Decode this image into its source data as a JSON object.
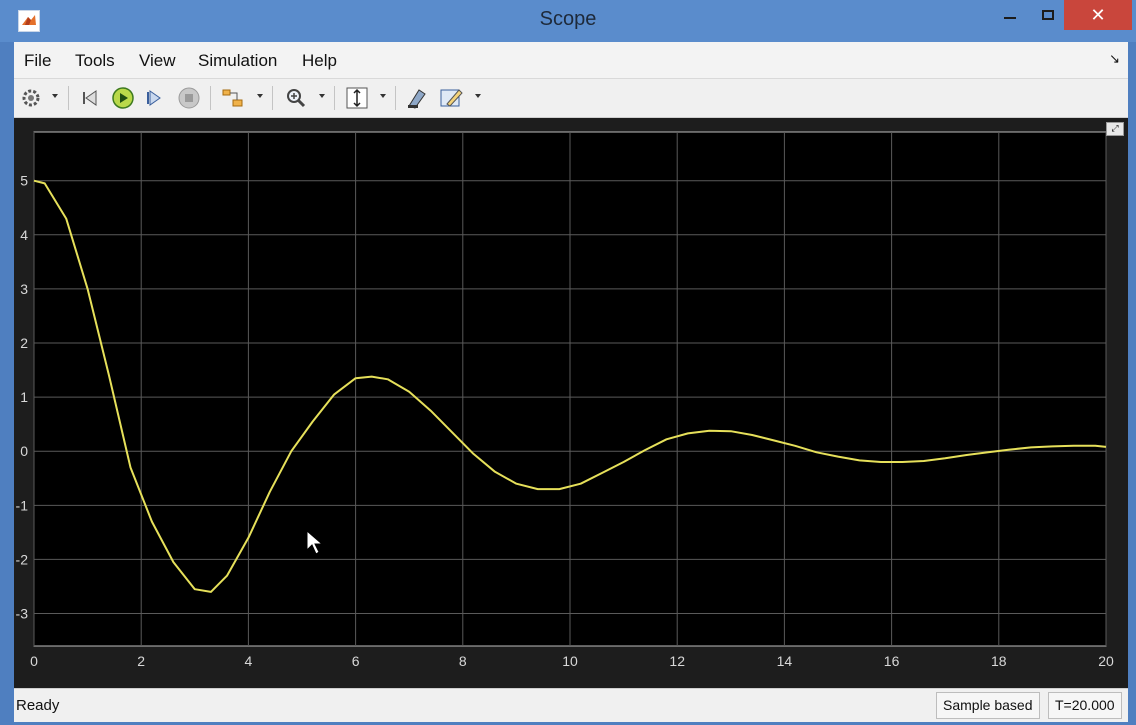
{
  "window": {
    "title": "Scope",
    "close_glyph": "✕"
  },
  "menu": [
    "File",
    "Tools",
    "View",
    "Simulation",
    "Help"
  ],
  "toolbar": {
    "icons": [
      "settings-icon",
      "step-back-icon",
      "run-icon",
      "step-forward-icon",
      "stop-icon",
      "highlight-simulink-block-icon",
      "zoom-in-icon",
      "autoscale-icon",
      "restore-view-icon",
      "style-icon"
    ]
  },
  "status": {
    "ready": "Ready",
    "mode": "Sample based",
    "time": "T=20.000"
  },
  "colors": {
    "plot_bg": "#000000",
    "line": "#e6e05a",
    "grid": "#5a5a5a",
    "tick": "#d8d8d8"
  },
  "chart_data": {
    "type": "line",
    "title": "",
    "xlabel": "",
    "ylabel": "",
    "xlim": [
      0,
      20
    ],
    "ylim": [
      -3.6,
      5.9
    ],
    "xticks": [
      0,
      2,
      4,
      6,
      8,
      10,
      12,
      14,
      16,
      18,
      20
    ],
    "yticks": [
      -3,
      -2,
      -1,
      0,
      1,
      2,
      3,
      4,
      5
    ],
    "grid": true,
    "series": [
      {
        "color": "#e6e05a",
        "x": [
          0,
          0.2,
          0.6,
          1.0,
          1.4,
          1.8,
          2.2,
          2.6,
          3.0,
          3.3,
          3.6,
          4.0,
          4.4,
          4.8,
          5.2,
          5.6,
          6.0,
          6.3,
          6.6,
          7.0,
          7.4,
          7.8,
          8.2,
          8.6,
          9.0,
          9.4,
          9.8,
          10.2,
          10.6,
          11.0,
          11.4,
          11.8,
          12.2,
          12.6,
          13.0,
          13.4,
          13.8,
          14.2,
          14.6,
          15.0,
          15.4,
          15.8,
          16.2,
          16.6,
          17.0,
          17.4,
          17.8,
          18.2,
          18.6,
          19.0,
          19.4,
          19.8,
          20.0
        ],
        "y": [
          5.0,
          4.95,
          4.3,
          3.0,
          1.4,
          -0.3,
          -1.3,
          -2.05,
          -2.55,
          -2.6,
          -2.3,
          -1.6,
          -0.75,
          0.0,
          0.55,
          1.05,
          1.35,
          1.38,
          1.33,
          1.1,
          0.75,
          0.35,
          -0.05,
          -0.38,
          -0.6,
          -0.7,
          -0.7,
          -0.6,
          -0.4,
          -0.2,
          0.02,
          0.22,
          0.33,
          0.38,
          0.37,
          0.3,
          0.2,
          0.1,
          -0.02,
          -0.1,
          -0.17,
          -0.2,
          -0.2,
          -0.18,
          -0.13,
          -0.07,
          -0.02,
          0.03,
          0.07,
          0.09,
          0.1,
          0.1,
          0.08
        ]
      }
    ]
  }
}
